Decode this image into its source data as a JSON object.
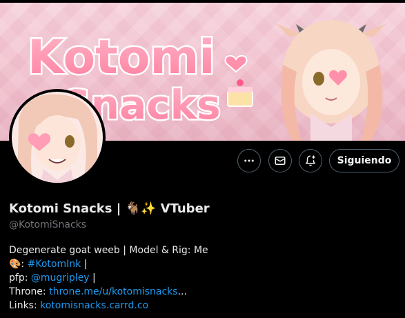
{
  "profile": {
    "display_name": "Kotomi Snacks | 🐐✨ VTuber",
    "handle": "@KotomiSnacks",
    "banner_logo_text": [
      "Kotomi",
      "Snacks"
    ]
  },
  "actions": {
    "more_icon": "more-horizontal-icon",
    "message_icon": "mail-icon",
    "notify_icon": "bell-plus-icon",
    "follow_label": "Siguiendo"
  },
  "bio": {
    "line1": "Degenerate goat weeb | Model & Rig: Me",
    "line2_prefix": "🎨: ",
    "line2_link": "#KotomInk",
    "line2_suffix": " |",
    "line3_prefix": "pfp: ",
    "line3_link": "@mugripley",
    "line3_suffix": " |",
    "line4_prefix": "Throne: ",
    "line4_link": "throne.me/u/kotomisnacks",
    "line4_suffix": "...",
    "line5_prefix": "Links: ",
    "line5_link": "kotomisnacks.carrd.co"
  },
  "colors": {
    "background": "#000000",
    "text": "#e7e9ea",
    "muted": "#71767b",
    "link": "#1d9bf0",
    "border": "#536471",
    "banner_pink": "#f1c2cf"
  }
}
